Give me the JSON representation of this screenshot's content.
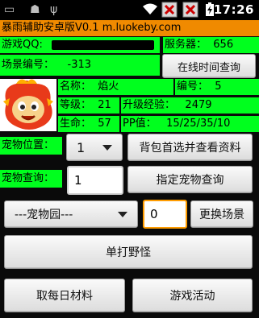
{
  "status": {
    "time": "17:26",
    "icons": [
      "battery-saver-icon",
      "android-debug-icon",
      "usb-icon",
      "wifi-icon",
      "notification-error-icon",
      "notification-error-icon",
      "battery-charging-icon"
    ]
  },
  "title": "暴雨辅助安卓版V0.1 m.luokeby.com",
  "account": {
    "qq_label": "游戏QQ:",
    "server_label": "服务器：",
    "server_value": "656"
  },
  "scene": {
    "label": "场景编号：",
    "value": "-313",
    "online_time_button": "在线时间查询"
  },
  "pet": {
    "name_label": "名称：",
    "name_value": "焰火",
    "number_label": "编号：",
    "number_value": "5",
    "level_label": "等级：",
    "level_value": "21",
    "exp_label": "升级经验：",
    "exp_value": "2479",
    "hp_label": "生命：",
    "hp_value": "57",
    "pp_label": "PP值：",
    "pp_value": "15/25/35/10"
  },
  "pet_position": {
    "label": "宠物位置：",
    "selected": "1",
    "button": "背包首选并查看资料"
  },
  "pet_query": {
    "label": "宠物查询：",
    "value": "1",
    "button": "指定宠物查询"
  },
  "scene_switch": {
    "selected": "---宠物园---",
    "value": "0",
    "button": "更换场景"
  },
  "actions": {
    "single_fight": "单打野怪",
    "daily_material": "取每日材料",
    "game_activity": "游戏活动"
  }
}
